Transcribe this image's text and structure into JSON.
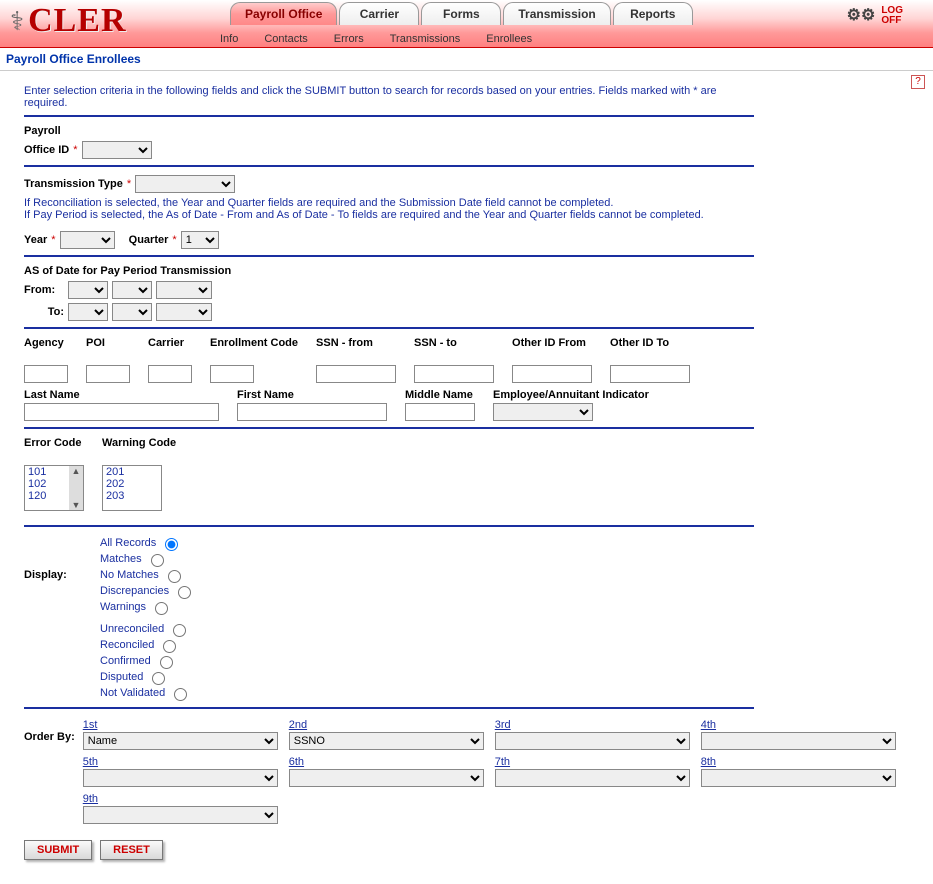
{
  "logo": {
    "text": "CLER"
  },
  "tabs": {
    "items": [
      "Payroll Office",
      "Carrier",
      "Forms",
      "Transmission",
      "Reports"
    ],
    "active_index": 0
  },
  "logoff": {
    "line1": "LOG",
    "line2": "OFF"
  },
  "subnav": [
    "Info",
    "Contacts",
    "Errors",
    "Transmissions",
    "Enrollees"
  ],
  "page_title": "Payroll Office Enrollees",
  "help": "?",
  "instructions": "Enter selection criteria in the following fields and click the SUBMIT button to search for records based on your entries.  Fields marked with * are required.",
  "labels": {
    "payroll": "Payroll",
    "office_id": "Office ID",
    "transmission_type": "Transmission Type",
    "trans_hint1": "If Reconciliation is selected, the Year and Quarter fields are required and the Submission Date field cannot be completed.",
    "trans_hint2": "If Pay Period is selected, the As of Date - From and As of Date - To fields are required and the Year and Quarter fields cannot be completed.",
    "year": "Year",
    "quarter": "Quarter",
    "quarter_val": "1",
    "asof": "AS of Date for Pay Period Transmission",
    "from": "From:",
    "to": "To:",
    "agency": "Agency",
    "poi": "POI",
    "carrier": "Carrier",
    "enroll_code": "Enrollment Code",
    "ssn_from": "SSN - from",
    "ssn_to": "SSN - to",
    "other_from": "Other ID From",
    "other_to": "Other ID To",
    "last": "Last Name",
    "first": "First Name",
    "middle": "Middle Name",
    "indicator": "Employee/Annuitant Indicator",
    "error_code": "Error Code",
    "warn_code": "Warning Code",
    "display": "Display:",
    "order_by": "Order By:"
  },
  "error_codes": [
    "101",
    "102",
    "120"
  ],
  "warn_codes": [
    "201",
    "202",
    "203"
  ],
  "display_options": {
    "row1": [
      "All Records",
      "Matches",
      "No Matches",
      "Discrepancies",
      "Warnings"
    ],
    "row2": [
      "Unreconciled",
      "Reconciled",
      "Confirmed",
      "Disputed",
      "Not Validated"
    ],
    "selected": "All Records"
  },
  "order_by": {
    "labels": [
      "1st",
      "2nd",
      "3rd",
      "4th",
      "5th",
      "6th",
      "7th",
      "8th",
      "9th"
    ],
    "values": [
      "Name",
      "SSNO",
      "",
      "",
      "",
      "",
      "",
      "",
      ""
    ]
  },
  "buttons": {
    "submit": "SUBMIT",
    "reset": "RESET"
  }
}
